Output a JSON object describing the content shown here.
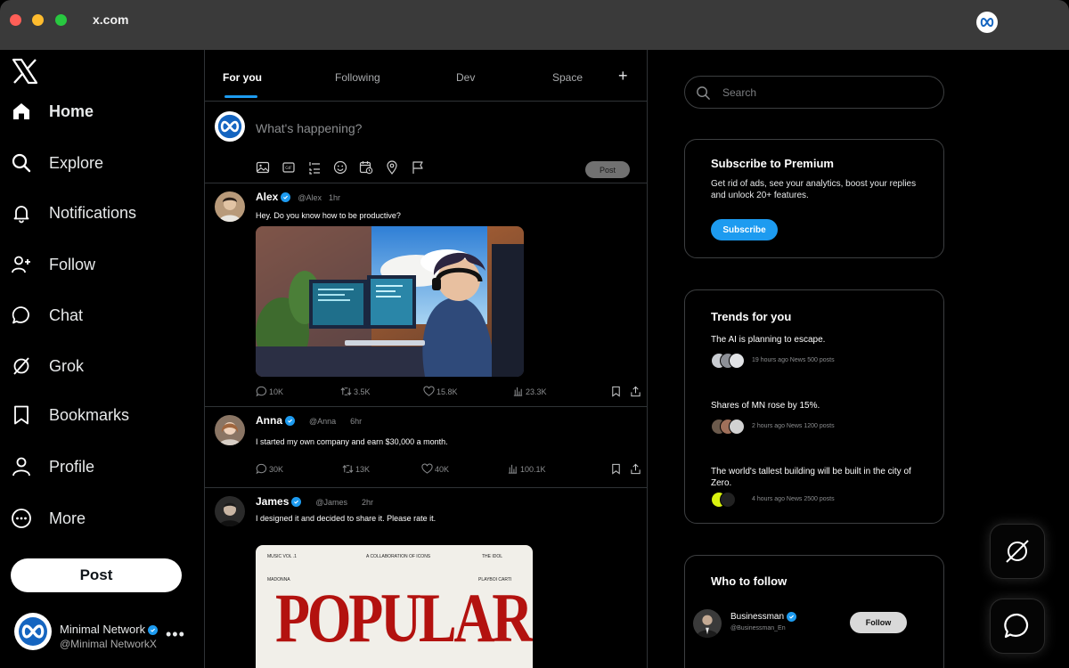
{
  "browser": {
    "url": "x.com"
  },
  "sidebar": {
    "items": [
      {
        "label": "Home",
        "icon": "home-icon"
      },
      {
        "label": "Explore",
        "icon": "search-icon"
      },
      {
        "label": "Notifications",
        "icon": "bell-icon"
      },
      {
        "label": "Follow",
        "icon": "add-person-icon"
      },
      {
        "label": "Chat",
        "icon": "chat-bubble-icon"
      },
      {
        "label": "Grok",
        "icon": "grok-icon"
      },
      {
        "label": "Bookmarks",
        "icon": "bookmark-icon"
      },
      {
        "label": "Profile",
        "icon": "person-icon"
      },
      {
        "label": "More",
        "icon": "more-circle-icon"
      }
    ],
    "post_label": "Post",
    "account": {
      "name": "Minimal Network",
      "handle": "@Minimal NetworkX",
      "more": "•••"
    }
  },
  "feed": {
    "tabs": [
      {
        "label": "For you"
      },
      {
        "label": "Following"
      },
      {
        "label": "Dev"
      },
      {
        "label": "Space"
      }
    ],
    "add_tab": "+",
    "compose": {
      "placeholder": "What's happening?",
      "post_label": "Post"
    },
    "tweets": [
      {
        "name": "Alex",
        "handle": "@Alex",
        "time": "1hr",
        "text": "Hey. Do you know how to be productive?",
        "replies": "10K",
        "reposts": "3.5K",
        "likes": "15.8K",
        "views": "23.3K"
      },
      {
        "name": "Anna",
        "handle": "@Anna",
        "time": "6hr",
        "text": "I started my own company and earn $30,000 a month.",
        "replies": "30K",
        "reposts": "13K",
        "likes": "40K",
        "views": "100.1K"
      },
      {
        "name": "James",
        "handle": "@James",
        "time": "2hr",
        "text": "I designed it and decided to share it. Please rate it.",
        "poster": {
          "top_left": "MUSIC VOL .1",
          "top_center": "A COLLABORATION OF ICONS",
          "top_right": "THE IDOL",
          "left_name": "MADONNA",
          "right_name": "PLAYBOI CARTI",
          "headline": "POPULAR"
        }
      }
    ]
  },
  "right": {
    "search_placeholder": "Search",
    "premium": {
      "title": "Subscribe to Premium",
      "description": "Get rid of ads, see your analytics, boost your replies and unlock 20+ features.",
      "button": "Subscribe"
    },
    "trends": {
      "title": "Trends for you",
      "items": [
        {
          "text": "The AI is planning to escape.",
          "info": "19 hours ago News 500 posts"
        },
        {
          "text": "Shares of MN rose by 15%.",
          "info": "2 hours ago News 1200 posts"
        },
        {
          "text": "The world's tallest building will be built in the city of Zero.",
          "info": "4 hours ago News 2500 posts"
        }
      ]
    },
    "who_to_follow": {
      "title": "Who to follow",
      "user": {
        "name": "Businessman",
        "handle": "@Businessman_En",
        "button": "Follow"
      }
    }
  },
  "colors": {
    "accent": "#1d9bf0",
    "background": "#000000",
    "border": "#2f3336"
  }
}
